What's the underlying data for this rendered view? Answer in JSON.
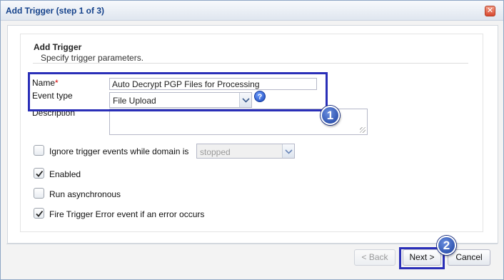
{
  "window": {
    "title": "Add Trigger (step 1 of 3)",
    "close_glyph": "✕"
  },
  "header": {
    "title": "Add Trigger",
    "subtitle": "Specify trigger parameters."
  },
  "form": {
    "name_label": "Name",
    "required_mark": "*",
    "name_value": "Auto Decrypt PGP Files for Processing",
    "event_type_label": "Event type",
    "event_type_value": "File Upload",
    "help_glyph": "?",
    "description_label": "Description",
    "description_value": ""
  },
  "options": [
    {
      "label": "Ignore trigger events while domain is",
      "checked": false
    },
    {
      "label": "Enabled",
      "checked": true
    },
    {
      "label": "Run asynchronous",
      "checked": false
    },
    {
      "label": "Fire Trigger Error event if an error occurs",
      "checked": true
    }
  ],
  "domain_state": {
    "value": "stopped",
    "disabled": true
  },
  "annotations": {
    "badge1": "1",
    "badge2": "2",
    "highlight_color": "#2a2fb8"
  },
  "footer": {
    "back_label": "< Back",
    "next_label": "Next >",
    "cancel_label": "Cancel"
  },
  "icons": {
    "checkbox_checked": "checkmark-icon",
    "combo_trigger": "chevron-down-icon",
    "help": "help-icon",
    "close": "close-icon"
  }
}
